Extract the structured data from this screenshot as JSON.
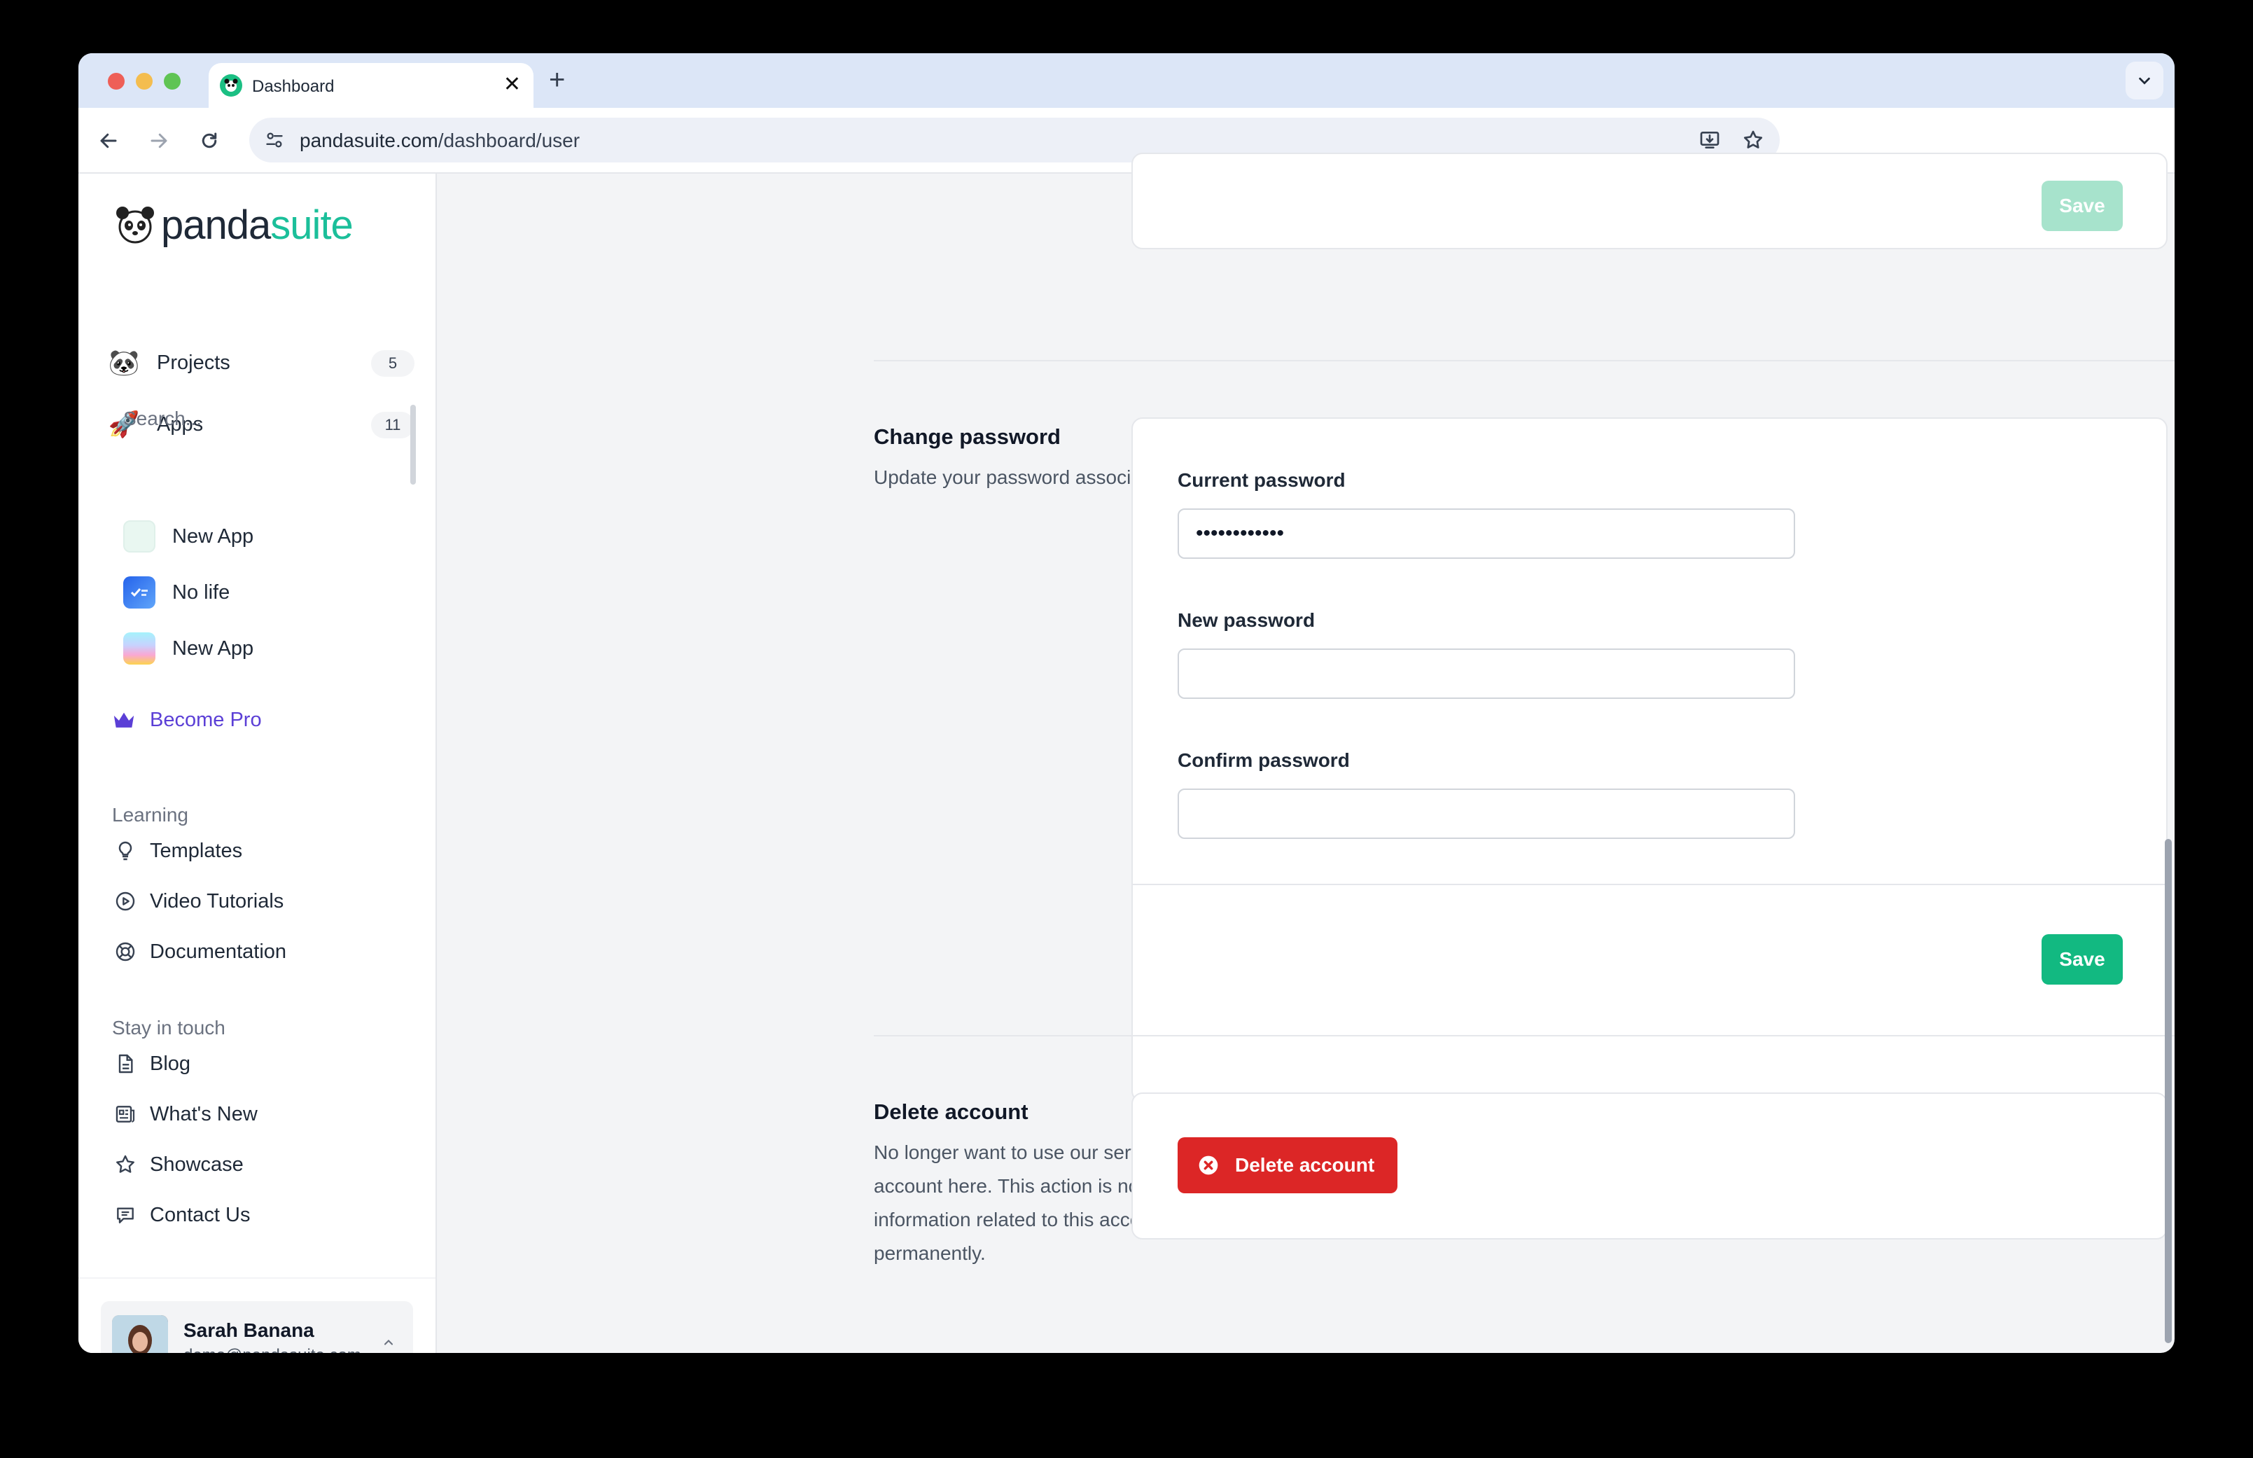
{
  "browser": {
    "tab_title": "Dashboard",
    "url_domain": "pandasuite.com",
    "url_path": "/dashboard/user"
  },
  "sidebar": {
    "logo": {
      "part1": "panda",
      "part2": "suite"
    },
    "nav": [
      {
        "label": "Projects",
        "count": "5",
        "icon": "panda-emoji"
      },
      {
        "label": "Apps",
        "count": "11",
        "icon": "rocket-emoji"
      }
    ],
    "search_placeholder": "Search...",
    "apps": [
      {
        "label": "New App",
        "icon": "app-thumb-light"
      },
      {
        "label": "No life",
        "icon": "app-thumb-blue"
      },
      {
        "label": "New App",
        "icon": "app-thumb-devices"
      }
    ],
    "become_pro": "Become Pro",
    "learning": {
      "title": "Learning",
      "items": [
        {
          "label": "Templates",
          "icon": "lightbulb-icon"
        },
        {
          "label": "Video Tutorials",
          "icon": "play-circle-icon"
        },
        {
          "label": "Documentation",
          "icon": "lifebuoy-icon"
        }
      ]
    },
    "stay_in_touch": {
      "title": "Stay in touch",
      "items": [
        {
          "label": "Blog",
          "icon": "document-icon"
        },
        {
          "label": "What's New",
          "icon": "newspaper-icon"
        },
        {
          "label": "Showcase",
          "icon": "star-icon"
        },
        {
          "label": "Contact Us",
          "icon": "chat-icon"
        }
      ]
    },
    "user": {
      "name": "Sarah Banana",
      "email": "demo@pandasuite.com"
    }
  },
  "main": {
    "top_save": "Save",
    "change_password": {
      "title": "Change password",
      "description": "Update your password associated with your account.",
      "current_label": "Current password",
      "current_value": "••••••••••••",
      "new_label": "New password",
      "new_value": "",
      "confirm_label": "Confirm password",
      "confirm_value": "",
      "save": "Save"
    },
    "delete_account": {
      "title": "Delete account",
      "description": "No longer want to use our service? You can delete your account here. This action is not reversible. All information related to this account will be deleted permanently.",
      "button": "Delete account"
    }
  },
  "colors": {
    "accent": "#12b981",
    "danger": "#dc2626",
    "pro": "#5b3fd6"
  }
}
